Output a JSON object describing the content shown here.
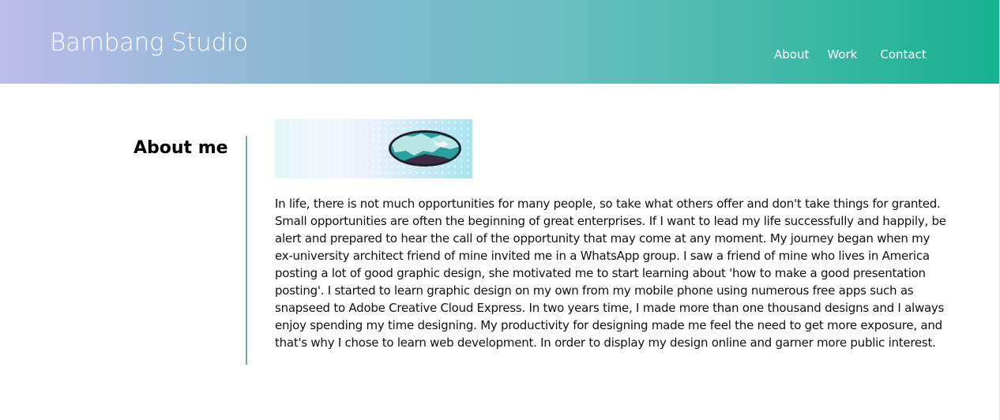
{
  "colors": {
    "header_gradient_start": "#bcbde9",
    "header_gradient_end": "#16b290",
    "divider": "#7fa6b8",
    "nav_text": "#ffffff"
  },
  "header": {
    "brand": "Bambang Studio",
    "nav": [
      {
        "label": "About"
      },
      {
        "label": "Work"
      },
      {
        "label": "Contact"
      }
    ]
  },
  "about": {
    "title": "About me",
    "image_icon": "globe-illustration",
    "paragraph": "In life, there is not much opportunities for many people, so take what others offer and don't take things for granted. Small opportunities are often the beginning of great enterprises. If I want to lead my life successfully and happily, be alert and prepared to hear the call of the opportunity that may come at any moment. My journey began when my ex-university architect friend of mine invited me in a WhatsApp group. I saw a friend of mine who lives in America posting a lot of good graphic design, she motivated me to start learning about 'how to make a good presentation posting'. I started to learn graphic design on my own from my mobile phone using numerous free apps such as snapseed to Adobe Creative Cloud Express. In two years time, I made more than one thousand designs and I always enjoy spending my time designing. My productivity for designing made me feel the need to get more exposure, and that's why I chose to learn web development. In order to display my design online and garner more public interest."
  }
}
